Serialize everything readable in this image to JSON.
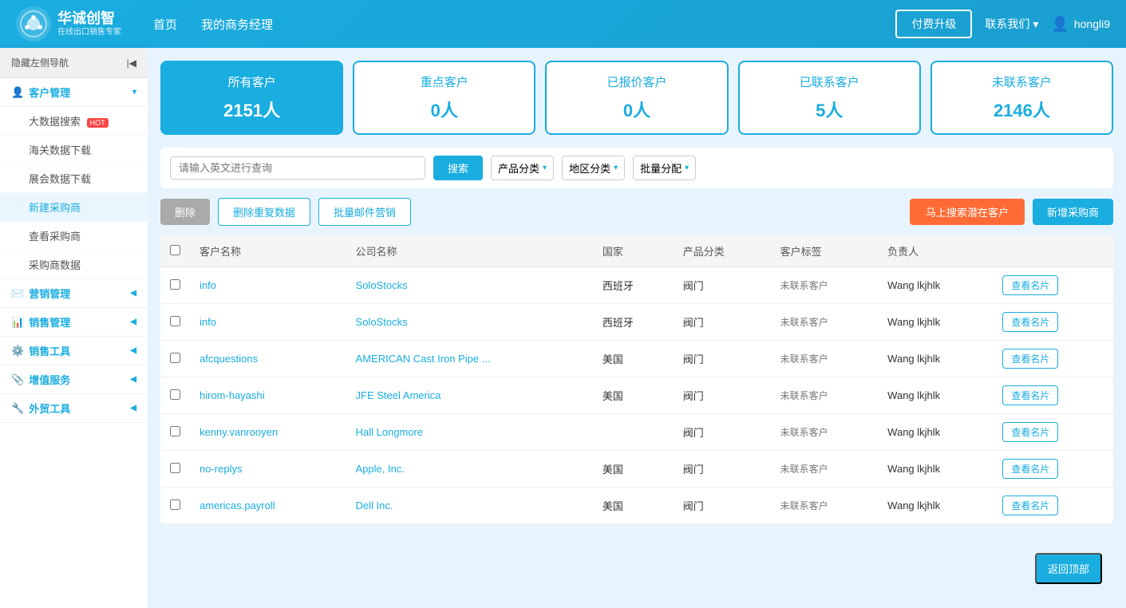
{
  "topnav": {
    "logo_main": "华诚创智",
    "logo_sub": "在线出口销售专家",
    "links": [
      "首页",
      "我的商务经理"
    ],
    "btn_upgrade": "付费升级",
    "contact": "联系我们",
    "user": "hongli9"
  },
  "sidebar": {
    "hide_btn": "隐藏左侧导航",
    "sections": [
      {
        "label": "客户管理",
        "icon": "👤",
        "active": true,
        "subs": [
          {
            "label": "大数据搜索",
            "hot": true,
            "active": false
          },
          {
            "label": "海关数据下载",
            "hot": false,
            "active": false
          },
          {
            "label": "展会数据下载",
            "hot": false,
            "active": false
          },
          {
            "label": "新建采购商",
            "hot": false,
            "active": true
          },
          {
            "label": "查看采购商",
            "hot": false,
            "active": false
          },
          {
            "label": "采购商数据",
            "hot": false,
            "active": false
          }
        ]
      },
      {
        "label": "营销管理",
        "icon": "✉️",
        "subs": []
      },
      {
        "label": "销售管理",
        "icon": "📊",
        "subs": []
      },
      {
        "label": "销售工具",
        "icon": "⚙️",
        "subs": []
      },
      {
        "label": "增值服务",
        "icon": "📎",
        "subs": []
      },
      {
        "label": "外贸工具",
        "icon": "🔧",
        "subs": []
      }
    ]
  },
  "stats": [
    {
      "label": "所有客户",
      "count": "2151人",
      "active": true
    },
    {
      "label": "重点客户",
      "count": "0人",
      "active": false
    },
    {
      "label": "已报价客户",
      "count": "0人",
      "active": false
    },
    {
      "label": "已联系客户",
      "count": "5人",
      "active": false
    },
    {
      "label": "未联系客户",
      "count": "2146人",
      "active": false
    }
  ],
  "filter": {
    "search_placeholder": "请输入英文进行查询",
    "search_btn": "搜索",
    "product_filter": "产品分类",
    "region_filter": "地区分类",
    "batch_filter": "批量分配"
  },
  "actions": {
    "delete": "删除",
    "delete_dup": "删除重复数据",
    "email_marketing": "批量邮件营销",
    "search_potential": "马上搜索潜在客户",
    "add_customer": "新增采购商"
  },
  "table": {
    "headers": [
      "客户名称",
      "公司名称",
      "国家",
      "产品分类",
      "客户标签",
      "负责人",
      ""
    ],
    "rows": [
      {
        "name": "info",
        "company": "SoloStocks",
        "country": "西班牙",
        "product": "阀门",
        "tag": "未联系客户",
        "owner": "Wang lkjhlk",
        "card_btn": "查看名片"
      },
      {
        "name": "info",
        "company": "SoloStocks",
        "country": "西班牙",
        "product": "阀门",
        "tag": "未联系客户",
        "owner": "Wang lkjhlk",
        "card_btn": "查看名片"
      },
      {
        "name": "afcquestions",
        "company": "AMERICAN Cast Iron Pipe ...",
        "country": "美国",
        "product": "阀门",
        "tag": "未联系客户",
        "owner": "Wang lkjhlk",
        "card_btn": "查看名片"
      },
      {
        "name": "hirom-hayashi",
        "company": "JFE Steel America",
        "country": "美国",
        "product": "阀门",
        "tag": "未联系客户",
        "owner": "Wang lkjhlk",
        "card_btn": "查看名片"
      },
      {
        "name": "kenny.vanrooyen",
        "company": "Hall Longmore",
        "country": "",
        "product": "阀门",
        "tag": "未联系客户",
        "owner": "Wang lkjhlk",
        "card_btn": "查看名片"
      },
      {
        "name": "no-replys",
        "company": "Apple, Inc.",
        "country": "美国",
        "product": "阀门",
        "tag": "未联系客户",
        "owner": "Wang lkjhlk",
        "card_btn": "查看名片"
      },
      {
        "name": "americas.payroll",
        "company": "Dell Inc.",
        "country": "美国",
        "product": "阀门",
        "tag": "未联系客户",
        "owner": "Wang lkjhlk",
        "card_btn": "查看名片"
      }
    ]
  },
  "back_top": "返回顶部"
}
